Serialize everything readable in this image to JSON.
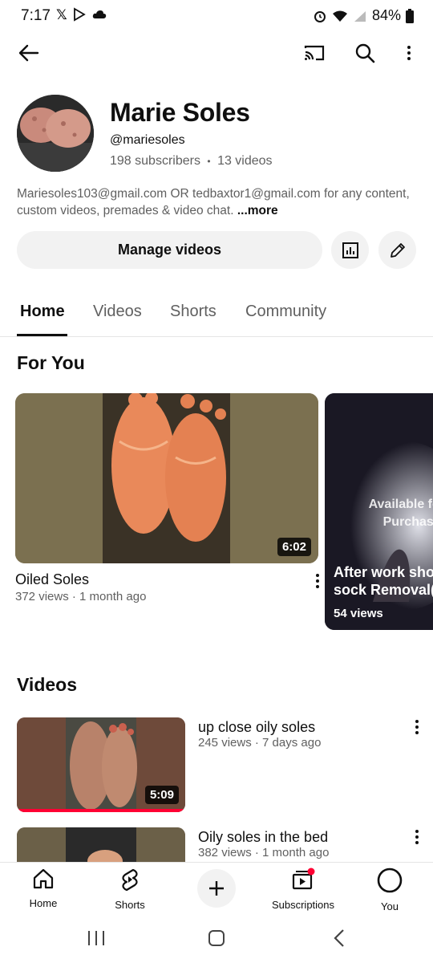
{
  "status": {
    "time": "7:17",
    "battery": "84%"
  },
  "channel": {
    "name": "Marie Soles",
    "handle": "@mariesoles",
    "subscribers": "198 subscribers",
    "separator": "•",
    "videos_count": "13 videos",
    "description": "Mariesoles103@gmail.com OR tedbaxtor1@gmail.com for any content, custom videos, premades & video chat.",
    "more": "...more",
    "manage_label": "Manage videos"
  },
  "tabs": [
    {
      "label": "Home"
    },
    {
      "label": "Videos"
    },
    {
      "label": "Shorts"
    },
    {
      "label": "Community"
    }
  ],
  "for_you": {
    "title": "For You",
    "video": {
      "title": "Oiled Soles",
      "meta": "372 views · 1 month ago",
      "duration": "6:02"
    },
    "short": {
      "promo": "Available for Purchase!",
      "title": "After work shoe & sock Removal(",
      "views": "54 views"
    }
  },
  "videos": {
    "title": "Videos",
    "items": [
      {
        "title": "up close oily soles",
        "meta": "245 views · 7 days ago",
        "duration": "5:09"
      },
      {
        "title": "Oily soles in the bed",
        "meta": "382 views · 1 month ago",
        "duration": ""
      }
    ]
  },
  "bottom_nav": [
    {
      "label": "Home",
      "icon": "home-icon"
    },
    {
      "label": "Shorts",
      "icon": "shorts-icon"
    },
    {
      "label": "",
      "icon": "create-icon"
    },
    {
      "label": "Subscriptions",
      "icon": "subscriptions-icon"
    },
    {
      "label": "You",
      "icon": "you-icon"
    }
  ],
  "colors": {
    "accent_red": "#ff0033",
    "text": "#0f0f0f",
    "secondary": "#606060",
    "chip": "#f2f2f2"
  }
}
